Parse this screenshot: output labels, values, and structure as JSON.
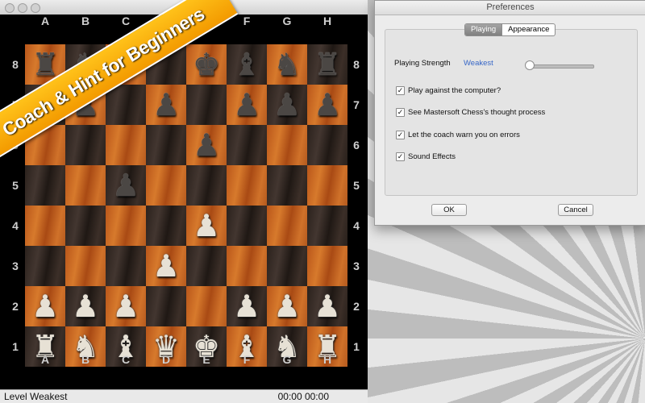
{
  "banner": {
    "text": "Coach & Hint for Beginners"
  },
  "board": {
    "files": [
      "A",
      "B",
      "C",
      "D",
      "E",
      "F",
      "G",
      "H"
    ],
    "ranks": [
      "8",
      "7",
      "6",
      "5",
      "4",
      "3",
      "2",
      "1"
    ],
    "pieces": [
      {
        "sq": "a8",
        "p": "rook",
        "c": "black",
        "g": "♜"
      },
      {
        "sq": "b8",
        "p": "knight",
        "c": "black",
        "g": "♞"
      },
      {
        "sq": "c8",
        "p": "bishop",
        "c": "black",
        "g": "♝"
      },
      {
        "sq": "e8",
        "p": "king",
        "c": "black",
        "g": "♚"
      },
      {
        "sq": "f8",
        "p": "bishop",
        "c": "black",
        "g": "♝"
      },
      {
        "sq": "g8",
        "p": "knight",
        "c": "black",
        "g": "♞"
      },
      {
        "sq": "h8",
        "p": "rook",
        "c": "black",
        "g": "♜"
      },
      {
        "sq": "a7",
        "p": "pawn",
        "c": "black",
        "g": "♟"
      },
      {
        "sq": "b7",
        "p": "pawn",
        "c": "black",
        "g": "♟"
      },
      {
        "sq": "d7",
        "p": "pawn",
        "c": "black",
        "g": "♟"
      },
      {
        "sq": "f7",
        "p": "pawn",
        "c": "black",
        "g": "♟"
      },
      {
        "sq": "g7",
        "p": "pawn",
        "c": "black",
        "g": "♟"
      },
      {
        "sq": "h7",
        "p": "pawn",
        "c": "black",
        "g": "♟"
      },
      {
        "sq": "e6",
        "p": "pawn",
        "c": "black",
        "g": "♟"
      },
      {
        "sq": "c5",
        "p": "pawn",
        "c": "black",
        "g": "♟"
      },
      {
        "sq": "e4",
        "p": "pawn",
        "c": "white",
        "g": "♟"
      },
      {
        "sq": "d3",
        "p": "pawn",
        "c": "white",
        "g": "♟"
      },
      {
        "sq": "a2",
        "p": "pawn",
        "c": "white",
        "g": "♟"
      },
      {
        "sq": "b2",
        "p": "pawn",
        "c": "white",
        "g": "♟"
      },
      {
        "sq": "c2",
        "p": "pawn",
        "c": "white",
        "g": "♟"
      },
      {
        "sq": "f2",
        "p": "pawn",
        "c": "white",
        "g": "♟"
      },
      {
        "sq": "g2",
        "p": "pawn",
        "c": "white",
        "g": "♟"
      },
      {
        "sq": "h2",
        "p": "pawn",
        "c": "white",
        "g": "♟"
      },
      {
        "sq": "a1",
        "p": "rook",
        "c": "white",
        "g": "♜"
      },
      {
        "sq": "b1",
        "p": "knight",
        "c": "white",
        "g": "♞"
      },
      {
        "sq": "c1",
        "p": "bishop",
        "c": "white",
        "g": "♝"
      },
      {
        "sq": "d1",
        "p": "queen",
        "c": "white",
        "g": "♛"
      },
      {
        "sq": "e1",
        "p": "king",
        "c": "white",
        "g": "♚"
      },
      {
        "sq": "f1",
        "p": "bishop",
        "c": "white",
        "g": "♝"
      },
      {
        "sq": "g1",
        "p": "knight",
        "c": "white",
        "g": "♞"
      },
      {
        "sq": "h1",
        "p": "rook",
        "c": "white",
        "g": "♜"
      }
    ]
  },
  "status": {
    "level": "Level Weakest",
    "clock": "00:00 00:00"
  },
  "preferences": {
    "title": "Preferences",
    "tabs": [
      {
        "label": "Playing",
        "active": true
      },
      {
        "label": "Appearance",
        "active": false
      }
    ],
    "strength_label": "Playing Strength",
    "strength_value": "Weakest",
    "strength_level": 0,
    "options": [
      {
        "label": "Play against the computer?",
        "checked": true
      },
      {
        "label": "See Mastersoft Chess's thought process",
        "checked": true
      },
      {
        "label": "Let the coach warn you on errors",
        "checked": true
      },
      {
        "label": "Sound Effects",
        "checked": true
      }
    ],
    "ok_label": "OK",
    "cancel_label": "Cancel"
  },
  "colors": {
    "banner": "#f5a300",
    "light_square": "#c6681f",
    "dark_square": "#332822",
    "link_blue": "#3767c7"
  }
}
